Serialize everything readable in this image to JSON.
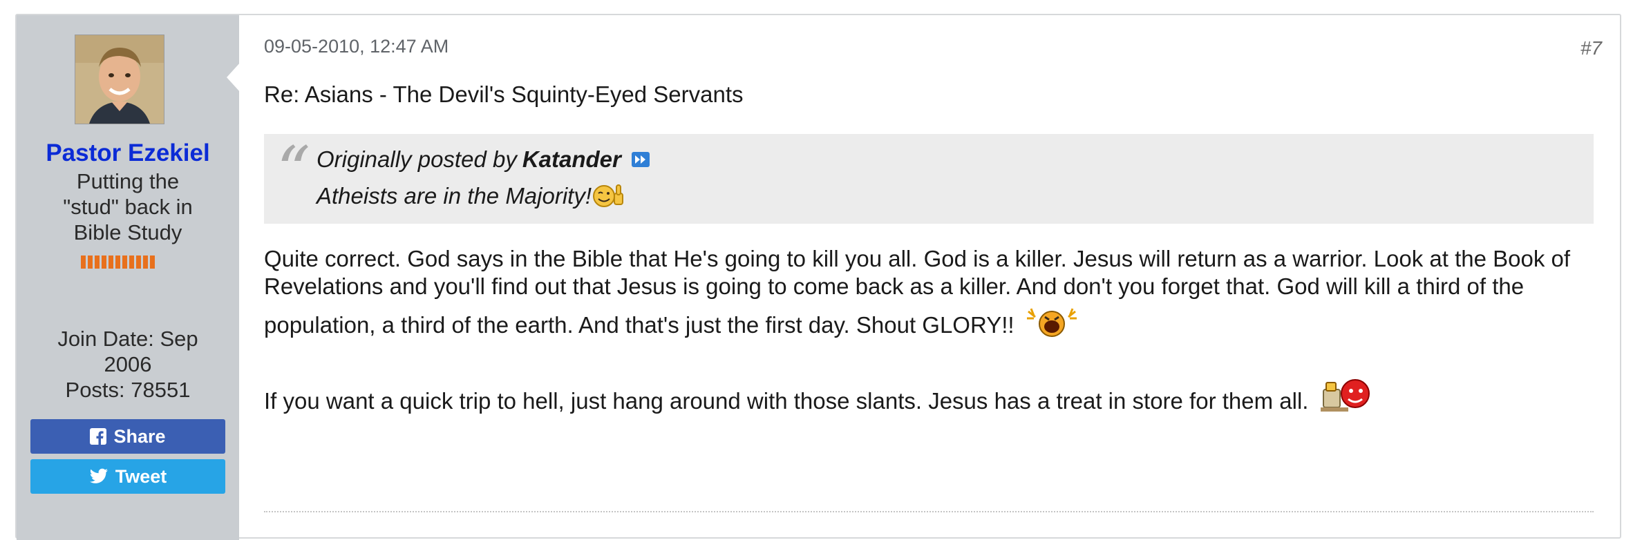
{
  "post": {
    "date": "09-05-2010, 12:47 AM",
    "number": "#7",
    "title": "Re: Asians - The Devil's Squinty-Eyed Servants"
  },
  "user": {
    "name": "Pastor Ezekiel",
    "title_lines": [
      "Putting the",
      "\"stud\" back in",
      "Bible Study"
    ],
    "join_date_label": "Join Date: Sep",
    "join_date_year": "2006",
    "posts": "Posts: 78551",
    "reputation_segments": 11
  },
  "social": {
    "share_label": "Share",
    "tweet_label": "Tweet"
  },
  "quote": {
    "prefix": "Originally posted by",
    "author": "Katander",
    "text": "Atheists are in the Majority!"
  },
  "message": {
    "paragraph1_line1": "Quite correct. God says in the Bible that He's going to kill you all. God is a killer. Jesus will return as a warrior. Look at the Book of",
    "paragraph1_line2": "Revelations and you'll find out that Jesus is going to come back as a killer. And don't you forget that. God will kill a third of the",
    "paragraph1_line3": "population, a third of the earth. And that's just the first day. Shout GLORY!!",
    "paragraph2": "If you want a quick trip to hell, just hang around with those slants. Jesus has a treat in store for them all."
  },
  "colors": {
    "username": "#0b2bd6",
    "share": "#3b5fb3",
    "tweet": "#27a4e6",
    "reputation": "#e8701c",
    "sidebar": "#c9cdd1"
  }
}
